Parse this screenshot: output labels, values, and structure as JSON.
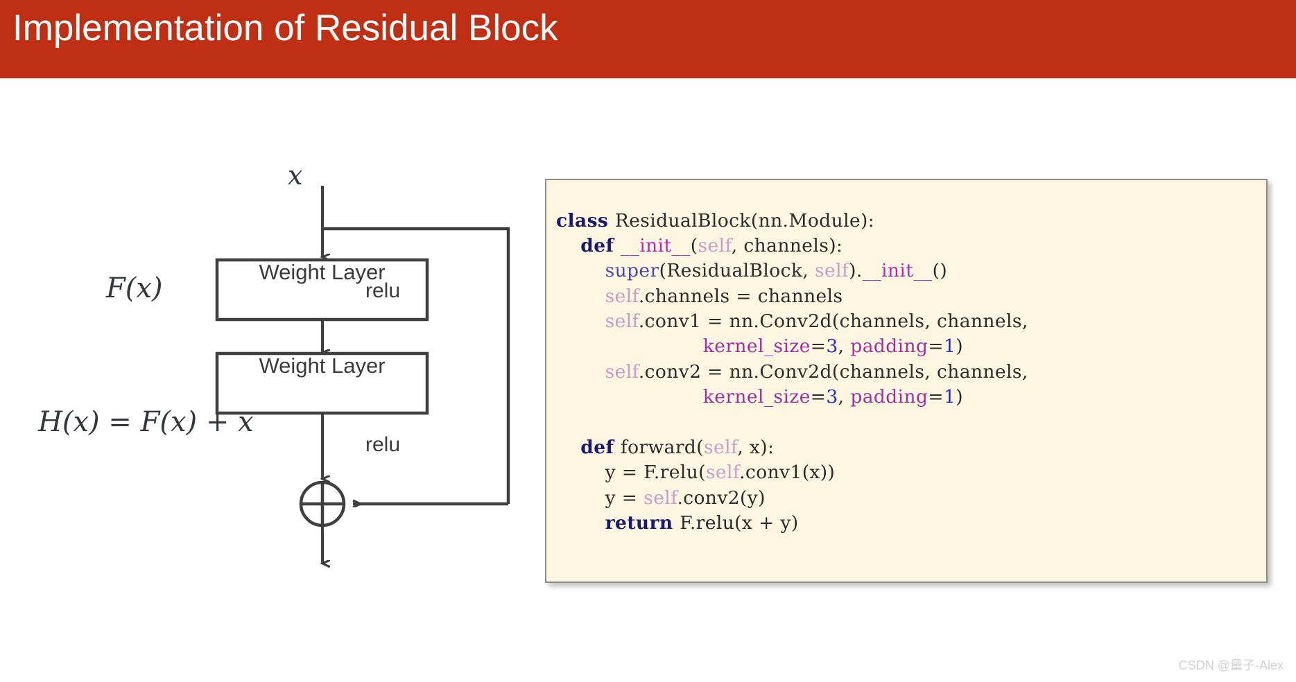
{
  "header": {
    "title": "Implementation of Residual Block",
    "bar_color": "#BF2F14",
    "title_color": "#FFFFFF"
  },
  "diagram": {
    "name": "residual-block-diagram",
    "input_label": "x",
    "residual_label": "F(x)",
    "output_label": "H(x) = F(x) + x",
    "blocks": [
      {
        "label": "Weight Layer"
      },
      {
        "label": "Weight Layer"
      }
    ],
    "activation_labels": [
      {
        "label": "relu"
      },
      {
        "label": "relu"
      }
    ],
    "sum_operator": "plus-circle",
    "stroke_color": "#3F3F3F"
  },
  "code": {
    "panel_bg": "#FDF6E0",
    "panel_border": "#8D8D86",
    "language": "python",
    "lines": [
      [
        {
          "t": "class ",
          "c": "kw"
        },
        {
          "t": "ResidualBlock(nn.Module):",
          "c": "plain"
        }
      ],
      [
        {
          "t": "    ",
          "c": "plain"
        },
        {
          "t": "def ",
          "c": "kw"
        },
        {
          "t": "__init__",
          "c": "dunder"
        },
        {
          "t": "(",
          "c": "plain"
        },
        {
          "t": "self",
          "c": "self"
        },
        {
          "t": ", channels):",
          "c": "plain"
        }
      ],
      [
        {
          "t": "        ",
          "c": "plain"
        },
        {
          "t": "super",
          "c": "func"
        },
        {
          "t": "(ResidualBlock, ",
          "c": "plain"
        },
        {
          "t": "self",
          "c": "self"
        },
        {
          "t": ").",
          "c": "plain"
        },
        {
          "t": "__init__",
          "c": "dunder"
        },
        {
          "t": "()",
          "c": "plain"
        }
      ],
      [
        {
          "t": "        ",
          "c": "plain"
        },
        {
          "t": "self",
          "c": "self"
        },
        {
          "t": ".channels = channels",
          "c": "plain"
        }
      ],
      [
        {
          "t": "        ",
          "c": "plain"
        },
        {
          "t": "self",
          "c": "self"
        },
        {
          "t": ".conv1 = nn.Conv2d(channels, channels,",
          "c": "plain"
        }
      ],
      [
        {
          "t": "                        ",
          "c": "plain"
        },
        {
          "t": "kernel_size",
          "c": "param"
        },
        {
          "t": "=",
          "c": "plain"
        },
        {
          "t": "3",
          "c": "num"
        },
        {
          "t": ", ",
          "c": "plain"
        },
        {
          "t": "padding",
          "c": "param"
        },
        {
          "t": "=",
          "c": "plain"
        },
        {
          "t": "1",
          "c": "num"
        },
        {
          "t": ")",
          "c": "plain"
        }
      ],
      [
        {
          "t": "        ",
          "c": "plain"
        },
        {
          "t": "self",
          "c": "self"
        },
        {
          "t": ".conv2 = nn.Conv2d(channels, channels,",
          "c": "plain"
        }
      ],
      [
        {
          "t": "                        ",
          "c": "plain"
        },
        {
          "t": "kernel_size",
          "c": "param"
        },
        {
          "t": "=",
          "c": "plain"
        },
        {
          "t": "3",
          "c": "num"
        },
        {
          "t": ", ",
          "c": "plain"
        },
        {
          "t": "padding",
          "c": "param"
        },
        {
          "t": "=",
          "c": "plain"
        },
        {
          "t": "1",
          "c": "num"
        },
        {
          "t": ")",
          "c": "plain"
        }
      ],
      [
        {
          "t": " ",
          "c": "plain"
        }
      ],
      [
        {
          "t": "    ",
          "c": "plain"
        },
        {
          "t": "def ",
          "c": "kw"
        },
        {
          "t": "forward(",
          "c": "plain"
        },
        {
          "t": "self",
          "c": "self"
        },
        {
          "t": ", x):",
          "c": "plain"
        }
      ],
      [
        {
          "t": "        y = F.relu(",
          "c": "plain"
        },
        {
          "t": "self",
          "c": "self"
        },
        {
          "t": ".conv1(x))",
          "c": "plain"
        }
      ],
      [
        {
          "t": "        y = ",
          "c": "plain"
        },
        {
          "t": "self",
          "c": "self"
        },
        {
          "t": ".conv2(y)",
          "c": "plain"
        }
      ],
      [
        {
          "t": "        ",
          "c": "plain"
        },
        {
          "t": "return ",
          "c": "kw"
        },
        {
          "t": "F.relu(x + y)",
          "c": "plain"
        }
      ]
    ]
  },
  "watermark": {
    "text": "CSDN @量子-Alex"
  }
}
